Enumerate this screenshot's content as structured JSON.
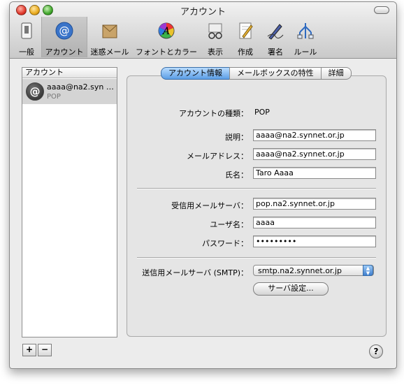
{
  "window": {
    "title": "アカウント"
  },
  "toolbar": {
    "items": [
      {
        "label": "一般",
        "icon": "switch-icon"
      },
      {
        "label": "アカウント",
        "icon": "at-sign-icon"
      },
      {
        "label": "迷惑メール",
        "icon": "junk-mail-icon"
      },
      {
        "label": "フォントとカラー",
        "icon": "color-wheel-icon"
      },
      {
        "label": "表示",
        "icon": "glasses-icon"
      },
      {
        "label": "作成",
        "icon": "pencil-paper-icon"
      },
      {
        "label": "署名",
        "icon": "pen-icon"
      },
      {
        "label": "ルール",
        "icon": "rules-icon"
      }
    ],
    "selected_index": 1
  },
  "accounts_list": {
    "header": "アカウント",
    "items": [
      {
        "name": "aaaa@na2.syn …",
        "type": "POP"
      }
    ]
  },
  "list_buttons": {
    "add": "+",
    "remove": "−"
  },
  "help": "?",
  "tabs": [
    "アカウント情報",
    "メールボックスの特性",
    "詳細"
  ],
  "form": {
    "account_type_label": "アカウントの種類：",
    "account_type_value": "POP",
    "description_label": "説明：",
    "description_value": "aaaa@na2.synnet.or.jp",
    "email_label": "メールアドレス：",
    "email_value": "aaaa@na2.synnet.or.jp",
    "fullname_label": "氏名：",
    "fullname_value": "Taro Aaaa",
    "incoming_label": "受信用メールサーバ：",
    "incoming_value": "pop.na2.synnet.or.jp",
    "username_label": "ユーザ名：",
    "username_value": "aaaa",
    "password_label": "パスワード：",
    "password_value": "•••••••••",
    "smtp_label": "送信用メールサーバ (SMTP)：",
    "smtp_value": "smtp.na2.synnet.or.jp",
    "server_settings_button": "サーバ設定..."
  }
}
